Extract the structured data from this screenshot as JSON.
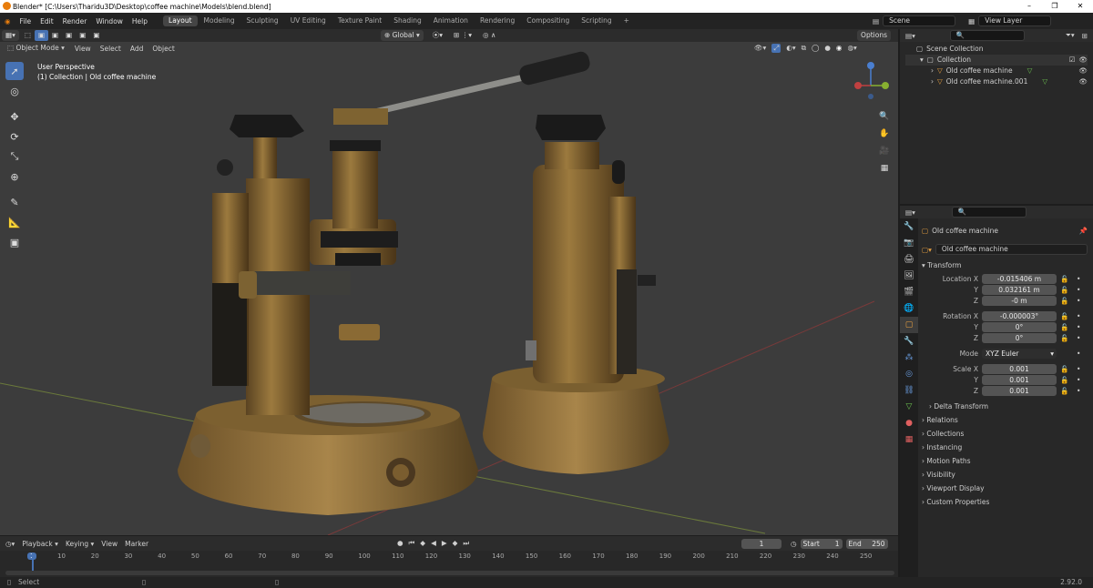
{
  "window": {
    "title": "Blender* [C:\\Users\\Tharidu3D\\Desktop\\coffee machine\\Models\\blend.blend]",
    "minimize": "–",
    "maximize": "❐",
    "close": "✕"
  },
  "menu": {
    "file": "File",
    "edit": "Edit",
    "render": "Render",
    "window": "Window",
    "help": "Help"
  },
  "workspaces": [
    "Layout",
    "Modeling",
    "Sculpting",
    "UV Editing",
    "Texture Paint",
    "Shading",
    "Animation",
    "Rendering",
    "Compositing",
    "Scripting"
  ],
  "scene": {
    "name": "Scene",
    "view_layer": "View Layer"
  },
  "viewport_header": {
    "mode": "Object Mode",
    "view": "View",
    "select": "Select",
    "add": "Add",
    "object": "Object",
    "orientation": "Global",
    "options": "Options"
  },
  "viewport": {
    "perspective": "User Perspective",
    "context": "(1) Collection | Old coffee machine"
  },
  "outliner": {
    "scene_collection": "Scene Collection",
    "collection": "Collection",
    "objects": [
      "Old coffee machine",
      "Old coffee machine.001"
    ]
  },
  "properties": {
    "object_name": "Old coffee machine",
    "object_field": "Old coffee machine",
    "transform_header": "Transform",
    "location_label": "Location X",
    "y": "Y",
    "z": "Z",
    "location": [
      "-0.015406 m",
      "0.032161 m",
      "-0 m"
    ],
    "rotation_label": "Rotation X",
    "rotation": [
      "-0.000003°",
      "0°",
      "0°"
    ],
    "mode_label": "Mode",
    "mode": "XYZ Euler",
    "scale_label": "Scale X",
    "scale": [
      "0.001",
      "0.001",
      "0.001"
    ],
    "delta": "Delta Transform",
    "panels": [
      "Relations",
      "Collections",
      "Instancing",
      "Motion Paths",
      "Visibility",
      "Viewport Display",
      "Custom Properties"
    ]
  },
  "timeline": {
    "playback": "Playback",
    "keying": "Keying",
    "view": "View",
    "marker": "Marker",
    "current_frame": "1",
    "start_label": "Start",
    "start": "1",
    "end_label": "End",
    "end": "250",
    "ticks": [
      "1",
      "10",
      "20",
      "30",
      "40",
      "50",
      "60",
      "70",
      "80",
      "90",
      "100",
      "110",
      "120",
      "130",
      "140",
      "150",
      "160",
      "170",
      "180",
      "190",
      "200",
      "210",
      "220",
      "230",
      "240",
      "250"
    ]
  },
  "status": {
    "select": "Select",
    "version": "2.92.0"
  },
  "colors": {
    "accent": "#4772b3",
    "brass": "#8a6a32",
    "header": "#2c2c2c",
    "viewport_bg": "#3c3c3c"
  }
}
